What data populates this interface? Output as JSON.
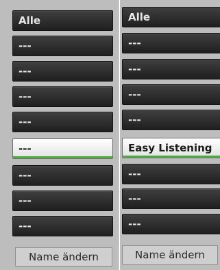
{
  "left_panel": {
    "items": [
      {
        "label": "Alle",
        "selected": false
      },
      {
        "label": "---",
        "selected": false
      },
      {
        "label": "---",
        "selected": false
      },
      {
        "label": "---",
        "selected": false
      },
      {
        "label": "---",
        "selected": false
      },
      {
        "label": "---",
        "selected": true
      },
      {
        "label": "---",
        "selected": false
      },
      {
        "label": "---",
        "selected": false
      },
      {
        "label": "---",
        "selected": false
      }
    ],
    "rename_label": "Name ändern"
  },
  "right_panel": {
    "items": [
      {
        "label": "Alle",
        "selected": false
      },
      {
        "label": "---",
        "selected": false
      },
      {
        "label": "---",
        "selected": false
      },
      {
        "label": "---",
        "selected": false
      },
      {
        "label": "---",
        "selected": false
      },
      {
        "label": "Easy Listening",
        "selected": true
      },
      {
        "label": "---",
        "selected": false
      },
      {
        "label": "---",
        "selected": false
      },
      {
        "label": "---",
        "selected": false
      }
    ],
    "rename_label": "Name ändern"
  },
  "colors": {
    "panel_background": "#bdbdbd",
    "item_background": "#2b2b2b",
    "selected_background": "#f2f2f2",
    "selected_accent": "#4caf3f"
  }
}
